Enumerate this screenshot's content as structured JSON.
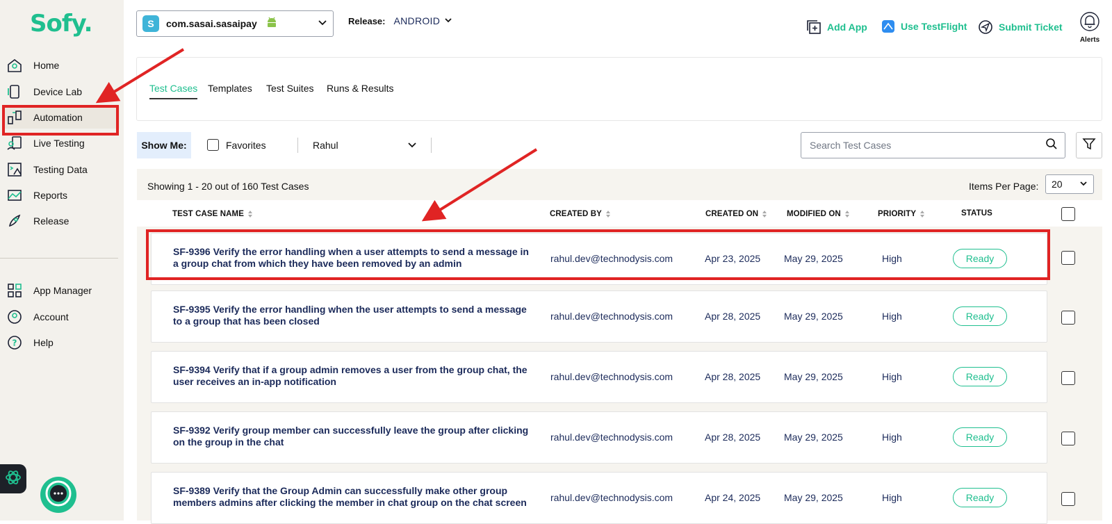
{
  "brand": {
    "logo_text": "Sofy.",
    "accent": "#1fbf8f"
  },
  "sidebar": {
    "items": [
      {
        "label": "Home",
        "icon": "home-icon"
      },
      {
        "label": "Device Lab",
        "icon": "device-icon"
      },
      {
        "label": "Automation",
        "icon": "automation-icon"
      },
      {
        "label": "Live Testing",
        "icon": "live-testing-icon"
      },
      {
        "label": "Testing Data",
        "icon": "testing-data-icon"
      },
      {
        "label": "Reports",
        "icon": "reports-icon"
      },
      {
        "label": "Release",
        "icon": "release-icon"
      }
    ],
    "bottom_items": [
      {
        "label": "App Manager",
        "icon": "grid-icon"
      },
      {
        "label": "Account",
        "icon": "account-icon"
      },
      {
        "label": "Help",
        "icon": "help-icon"
      }
    ]
  },
  "header": {
    "app_name": "com.sasai.sasaipay",
    "release_label": "Release:",
    "release_value": "ANDROID",
    "actions": {
      "add_app": "Add App",
      "testflight": "Use TestFlight",
      "ticket": "Submit Ticket"
    },
    "alerts_label": "Alerts"
  },
  "tabs": [
    "Test Cases",
    "Templates",
    "Test Suites",
    "Runs & Results"
  ],
  "filters": {
    "show_me": "Show Me:",
    "favorites": "Favorites",
    "user": "Rahul",
    "search_placeholder": "Search Test Cases"
  },
  "table": {
    "showing": "Showing 1 - 20 out of 160 Test Cases",
    "items_per_page_label": "Items Per Page:",
    "items_per_page": "20",
    "columns": [
      "TEST CASE NAME",
      "CREATED BY",
      "CREATED ON",
      "MODIFIED ON",
      "PRIORITY",
      "STATUS"
    ],
    "rows": [
      {
        "name": "SF-9396 Verify the error handling when a user attempts to send a message in a group chat from which they have been removed by an admin",
        "created_by": "rahul.dev@technodysis.com",
        "created_on": "Apr 23, 2025",
        "modified_on": "May 29, 2025",
        "priority": "High",
        "status": "Ready"
      },
      {
        "name": "SF-9395 Verify the error handling when the user attempts to send a message to a group that has been closed",
        "created_by": "rahul.dev@technodysis.com",
        "created_on": "Apr 28, 2025",
        "modified_on": "May 29, 2025",
        "priority": "High",
        "status": "Ready"
      },
      {
        "name": "SF-9394 Verify that if a group admin removes a user from the group chat, the user receives an in-app notification",
        "created_by": "rahul.dev@technodysis.com",
        "created_on": "Apr 28, 2025",
        "modified_on": "May 29, 2025",
        "priority": "High",
        "status": "Ready"
      },
      {
        "name": "SF-9392 Verify group member can successfully leave the group after clicking on the group in the chat",
        "created_by": "rahul.dev@technodysis.com",
        "created_on": "Apr 28, 2025",
        "modified_on": "May 29, 2025",
        "priority": "High",
        "status": "Ready"
      },
      {
        "name": "SF-9389 Verify that the Group Admin can successfully make other group members admins after clicking the member in chat group on the chat screen",
        "created_by": "rahul.dev@technodysis.com",
        "created_on": "Apr 24, 2025",
        "modified_on": "May 29, 2025",
        "priority": "High",
        "status": "Ready"
      }
    ]
  }
}
